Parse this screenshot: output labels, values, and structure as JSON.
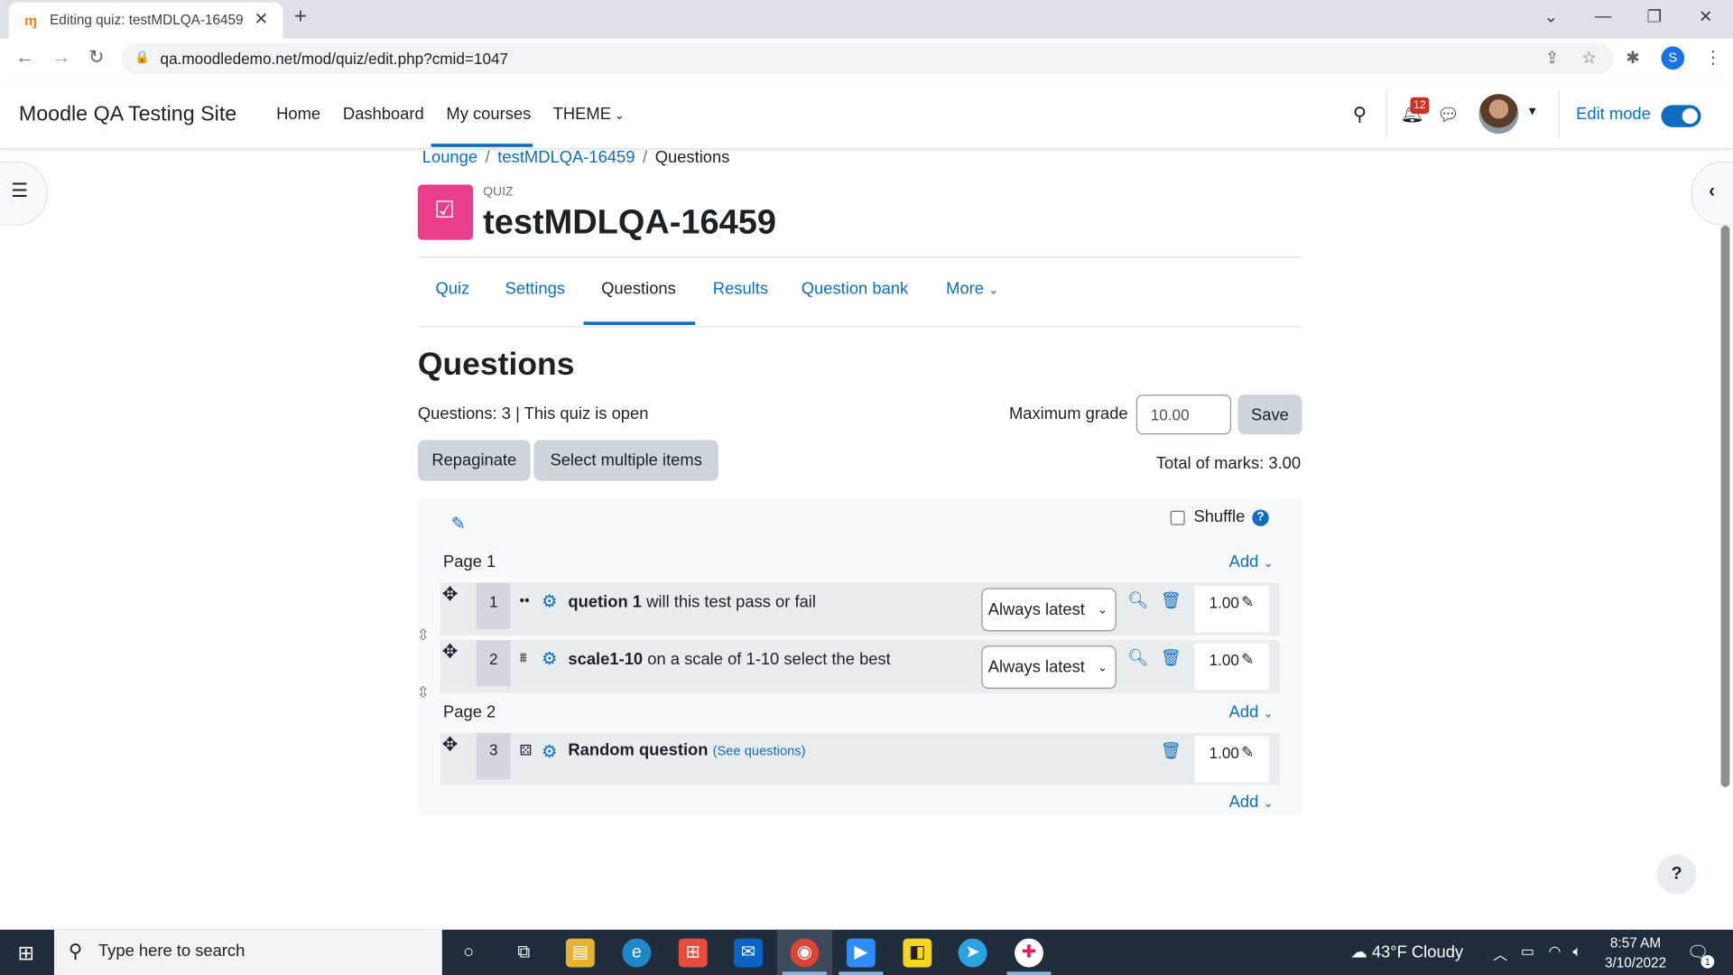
{
  "browser": {
    "tab_title": "Editing quiz: testMDLQA-16459",
    "url": "qa.moodledemo.net/mod/quiz/edit.php?cmid=1047",
    "profile_initial": "S"
  },
  "navbar": {
    "site_name": "Moodle QA Testing Site",
    "items": [
      "Home",
      "Dashboard",
      "My courses",
      "THEME"
    ],
    "notification_count": "12",
    "edit_mode_label": "Edit mode"
  },
  "breadcrumb": [
    "Lounge",
    "testMDLQA-16459",
    "Questions"
  ],
  "header": {
    "activity_type": "QUIZ",
    "title": "testMDLQA-16459"
  },
  "secondary_nav": [
    "Quiz",
    "Settings",
    "Questions",
    "Results",
    "Question bank",
    "More"
  ],
  "questions_page": {
    "heading": "Questions",
    "status": "Questions: 3 | This quiz is open",
    "max_grade_label": "Maximum grade",
    "max_grade_value": "10.00",
    "save_label": "Save",
    "repaginate_label": "Repaginate",
    "select_multiple_label": "Select multiple items",
    "total_marks": "Total of marks: 3.00",
    "shuffle_label": "Shuffle",
    "add_label": "Add",
    "pages": [
      {
        "label": "Page 1",
        "slots": [
          {
            "number": "1",
            "name": "quetion 1",
            "text": "will this test pass or fail",
            "version": "Always latest",
            "mark": "1.00"
          },
          {
            "number": "2",
            "name": "scale1-10",
            "text": "on a scale of 1-10 select the best",
            "version": "Always latest",
            "mark": "1.00"
          }
        ]
      },
      {
        "label": "Page 2",
        "slots": [
          {
            "number": "3",
            "name": "Random question",
            "link": "(See questions)",
            "mark": "1.00"
          }
        ]
      }
    ]
  },
  "taskbar": {
    "search_placeholder": "Type here to search",
    "weather": "43°F  Cloudy",
    "time": "8:57 AM",
    "date": "3/10/2022",
    "notification_count": "1"
  },
  "colors": {
    "brand_blue": "#0f6cbf",
    "quiz_icon": "#e83e8c",
    "badge_red": "#ca3120",
    "taskbar": "#202d3b"
  }
}
